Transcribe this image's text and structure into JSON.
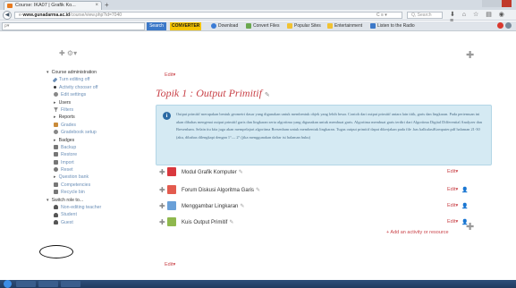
{
  "browser": {
    "tab_title": "Course: IKA07 | Grafik Ko...",
    "tab_close": "×",
    "new_tab": "+",
    "url_prefix": "e-",
    "url_host": "www.gunadarma.ac.id",
    "url_path": "/course/view.php?id=7040",
    "url_controls": "C  ≡  ▾",
    "search_placeholder": "Q, Search",
    "nav_icons": "⬇ ⌂ ☆ ▤ ◉ ≡",
    "back_icon": "◀"
  },
  "toolbar": {
    "search_placeholder": "ρ▾",
    "search_button": "Search",
    "converter_logo": "CONVERTER",
    "items": {
      "download": "Download",
      "convert_files": "Convert Files",
      "popular_sites": "Popular Sites",
      "entertainment": "Entertainment",
      "listen_radio": "Listen to the Radio"
    }
  },
  "page": {
    "top_gear": "✚  ⚙▾",
    "top_plus": "✚",
    "admin": {
      "course_admin": "Course administration",
      "turn_editing_off": "Turn editing off",
      "activity_chooser_off": "Activity chooser off",
      "edit_settings": "Edit settings",
      "users": "Users",
      "filters": "Filters",
      "reports": "Reports",
      "grades": "Grades",
      "gradebook_setup": "Gradebook setup",
      "badges": "Badges",
      "backup": "Backup",
      "restore": "Restore",
      "import": "Import",
      "reset": "Reset",
      "question_bank": "Question bank",
      "competencies": "Competencies",
      "recycle_bin": "Recycle bin",
      "switch_role": "Switch role to...",
      "non_editing_teacher": "Non-editing teacher",
      "student": "Student",
      "guest": "Guest"
    },
    "edit_top": "Edit▾",
    "topic_title": "Topik 1 : Output Primitif",
    "topic_pencil": "✎",
    "info_icon": "i",
    "info_text": "Output primitif merupakan bentuk geometri dasar yang digunakan untuk membentuk objek yang lebih besar. Contoh dari output primitif antara lain titik, garis dan lingkaran. Pada pertemuan ini akan dibahas mengenai output primitif garis dan lingkaran serta algoritma yang digunakan untuk membuat garis. Algoritma membuat garis terdiri dari Algoritma Digital Differential Analyzer dan Bresenham. Selain itu kita juga akan mempelajari algoritma Bresenham untuk membentuk lingkaran. Tugas output primitif dapat dikerjakan pada file .bas kalkulasiKomputer.pdf halaman 21-30 (aku, dibahas dilengkapi dengan 1°— 2° (jika menggunakan daftar isi halaman buku)",
    "activities": [
      {
        "name": "Modul Grafik Komputer",
        "edit": "Edit▾",
        "user": ""
      },
      {
        "name": "Forum Diskusi Algoritma Garis",
        "edit": "Edit▾",
        "user": "👤"
      },
      {
        "name": "Menggambar Lingkaran",
        "edit": "Edit▾",
        "user": "👤"
      },
      {
        "name": "Kuis Output Primitif",
        "edit": "Edit▾",
        "user": "👤"
      }
    ],
    "activity_pencil": "✎",
    "activity_move": "✚",
    "add_activity": "+ Add an activity or resource",
    "bottom_plus": "✚",
    "edit_bottom": "Edit▾"
  },
  "colors": {
    "link_red": "#c9444a",
    "info_bg": "#d5eaf3",
    "admin_link": "#6b8fb7"
  }
}
